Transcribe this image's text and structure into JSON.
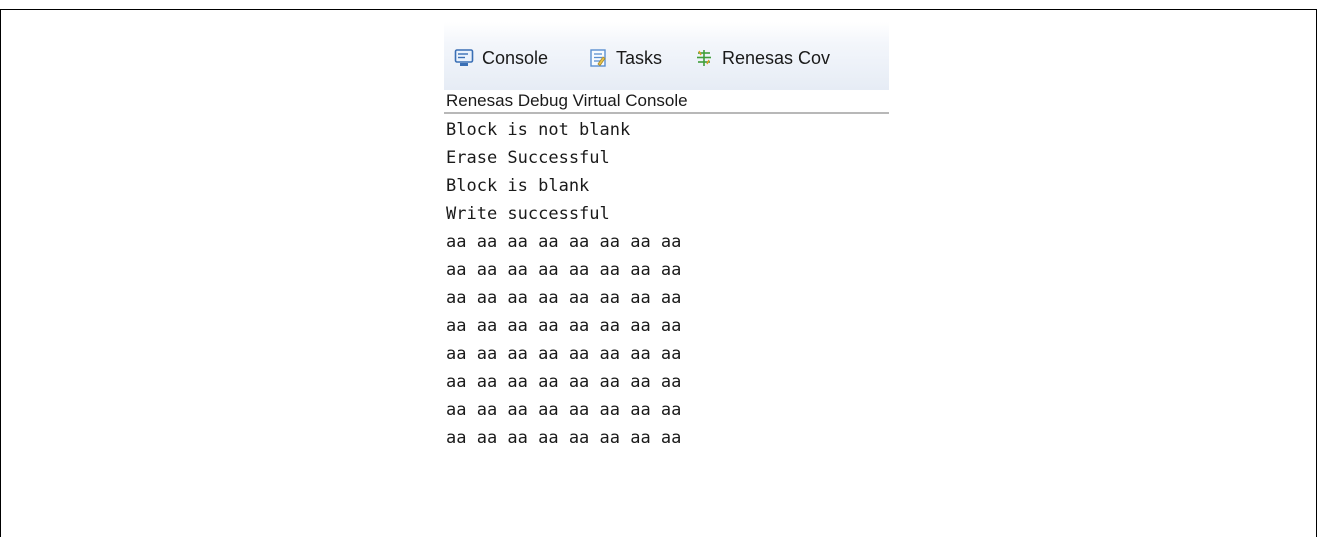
{
  "tabs": [
    {
      "label": "Console",
      "icon": "console-icon"
    },
    {
      "label": "Tasks",
      "icon": "tasks-icon"
    },
    {
      "label": "Renesas Cov",
      "icon": "coverage-icon"
    }
  ],
  "console": {
    "title": "Renesas Debug Virtual Console",
    "lines": [
      "Block is not blank",
      "Erase Successful",
      "Block is blank",
      "Write successful",
      "aa aa aa aa aa aa aa aa",
      "aa aa aa aa aa aa aa aa",
      "aa aa aa aa aa aa aa aa",
      "aa aa aa aa aa aa aa aa",
      "aa aa aa aa aa aa aa aa",
      "aa aa aa aa aa aa aa aa",
      "aa aa aa aa aa aa aa aa",
      "aa aa aa aa aa aa aa aa"
    ]
  },
  "colors": {
    "console_icon": "#3a6fb5",
    "tasks_icon": "#5a8fd0",
    "coverage_icon": "#3f9e3a"
  }
}
